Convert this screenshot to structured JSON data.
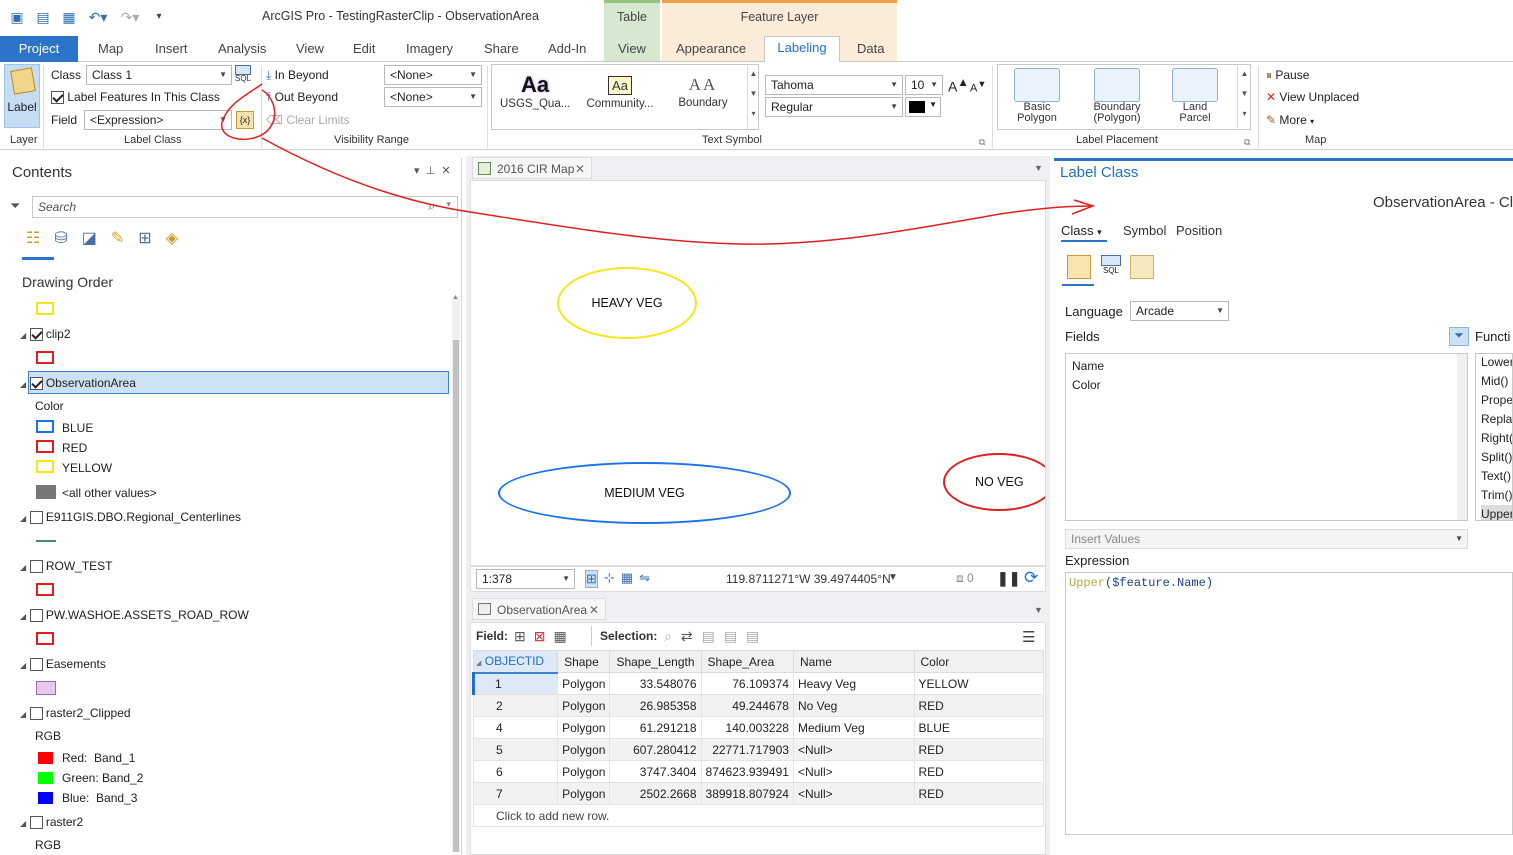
{
  "app": {
    "title": "ArcGIS Pro - TestingRasterClip - ObservationArea",
    "context_table": "Table",
    "context_feature_layer": "Feature Layer"
  },
  "tabs": [
    "Project",
    "Map",
    "Insert",
    "Analysis",
    "View",
    "Edit",
    "Imagery",
    "Share",
    "Add-In",
    "View",
    "Appearance",
    "Labeling",
    "Data"
  ],
  "ribbon": {
    "layer": {
      "label_button": "Label",
      "group": "Layer"
    },
    "label_class": {
      "class_label": "Class",
      "class_value": "Class 1",
      "sql_label": "SQL",
      "label_features": "Label Features In This Class",
      "field_label": "Field",
      "field_value": "<Expression>",
      "group": "Label Class"
    },
    "visibility": {
      "in_beyond": "In Beyond",
      "out_beyond": "Out Beyond",
      "clear_limits": "Clear Limits",
      "in_value": "<None>",
      "out_value": "<None>",
      "group": "Visibility Range"
    },
    "text_symbol": {
      "styles": [
        {
          "glyph": "Aa",
          "label": "USGS_Qua..."
        },
        {
          "glyph": "Aa",
          "label": "Community..."
        },
        {
          "glyph": "AA",
          "label": "Boundary"
        }
      ],
      "font": "Tahoma",
      "size": "10",
      "style": "Regular",
      "grow": "A",
      "shrink": "A",
      "group": "Text Symbol"
    },
    "placement": {
      "items": [
        {
          "label": "Basic Polygon"
        },
        {
          "label": "Boundary (Polygon)"
        },
        {
          "label": "Land Parcel"
        }
      ],
      "group": "Label Placement"
    },
    "map": {
      "pause": "Pause",
      "view_unplaced": "View Unplaced",
      "more": "More",
      "group": "Map"
    }
  },
  "contents": {
    "title": "Contents",
    "search_placeholder": "Search",
    "drawing_order": "Drawing Order",
    "layers": {
      "clip2": "clip2",
      "observation": "ObservationArea",
      "color_field": "Color",
      "blue": "BLUE",
      "red": "RED",
      "yellow": "YELLOW",
      "other": "<all other values>",
      "centerlines": "E911GIS.DBO.Regional_Centerlines",
      "row_test": "ROW_TEST",
      "road_row": "PW.WASHOE.ASSETS_ROAD_ROW",
      "easements": "Easements",
      "raster2_clipped": "raster2_Clipped",
      "rgb": "RGB",
      "red_band": "Red:",
      "red_band_name": "Band_1",
      "green_band": "Green:",
      "green_band_name": "Band_2",
      "blue_band": "Blue:",
      "blue_band_name": "Band_3",
      "raster2": "raster2",
      "rgb2": "RGB"
    }
  },
  "map": {
    "tab": "2016 CIR Map",
    "labels": {
      "heavy": "HEAVY VEG",
      "medium": "MEDIUM VEG",
      "no": "NO VEG"
    },
    "scale": "1:378",
    "coords": "119.8711271°W 39.4974405°N",
    "selected_count": "0"
  },
  "attribute_table": {
    "tab": "ObservationArea",
    "field_label": "Field:",
    "selection_label": "Selection:",
    "columns": [
      "OBJECTID",
      "Shape",
      "Shape_Length",
      "Shape_Area",
      "Name",
      "Color"
    ],
    "rows": [
      [
        "1",
        "Polygon",
        "33.548076",
        "76.109374",
        "Heavy Veg",
        "YELLOW"
      ],
      [
        "2",
        "Polygon",
        "26.985358",
        "49.244678",
        "No Veg",
        "RED"
      ],
      [
        "4",
        "Polygon",
        "61.291218",
        "140.003228",
        "Medium Veg",
        "BLUE"
      ],
      [
        "5",
        "Polygon",
        "607.280412",
        "22771.717903",
        "<Null>",
        "RED"
      ],
      [
        "6",
        "Polygon",
        "3747.3404",
        "874623.939491",
        "<Null>",
        "RED"
      ],
      [
        "7",
        "Polygon",
        "2502.2668",
        "389918.807924",
        "<Null>",
        "RED"
      ]
    ],
    "add_row": "Click to add new row."
  },
  "label_class_pane": {
    "title": "Label Class",
    "layer_name": "ObservationArea - Cl",
    "subtabs": [
      "Class",
      "Symbol",
      "Position"
    ],
    "sql_label": "SQL",
    "language_label": "Language",
    "language_value": "Arcade",
    "fields_label": "Fields",
    "fields": [
      "Name",
      "Color"
    ],
    "functions_label": "Functi",
    "functions": [
      "Lower",
      "Mid()",
      "Proper",
      "Replac",
      "Right(",
      "Split()",
      "Text()",
      "Trim()",
      "Upper"
    ],
    "insert_values": "Insert Values",
    "expression_label": "Expression",
    "expression_fn": "Upper",
    "expression_arg": "($feature.Name)"
  },
  "colors": {
    "accent": "#2b74c9",
    "red_ink": "#e02020",
    "yellow": "#f5e61a",
    "blue": "#1a73e8",
    "red": "#e02020"
  }
}
